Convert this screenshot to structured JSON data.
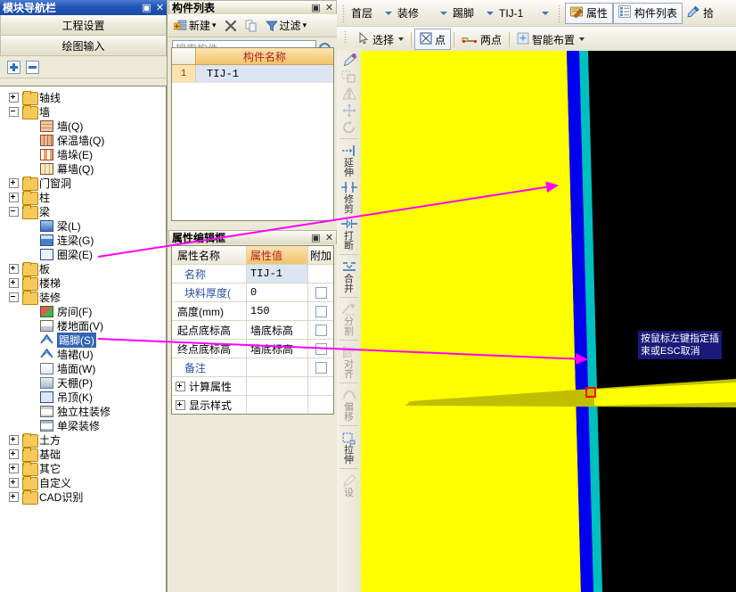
{
  "nav_panel": {
    "title": "模块导航栏",
    "pin": "▣",
    "close": "✕",
    "buttons": [
      {
        "label": "工程设置"
      },
      {
        "label": "绘图输入"
      }
    ],
    "expand_all": "+",
    "collapse_all": "-",
    "tree": [
      {
        "label": "轴线",
        "type": "folder",
        "state": "collapsed",
        "level": 0,
        "icon": "folder-icon"
      },
      {
        "label": "墙",
        "type": "folder",
        "state": "expanded",
        "level": 0,
        "icon": "folder-icon"
      },
      {
        "label": "墙(Q)",
        "type": "leaf",
        "level": 1,
        "icon": "wall-brick-icon"
      },
      {
        "label": "保温墙(Q)",
        "type": "leaf",
        "level": 1,
        "icon": "insulation-wall-icon"
      },
      {
        "label": "墙垛(E)",
        "type": "leaf",
        "level": 1,
        "icon": "wall-pier-icon"
      },
      {
        "label": "幕墙(Q)",
        "type": "leaf",
        "level": 1,
        "icon": "curtain-wall-icon"
      },
      {
        "label": "门窗洞",
        "type": "folder",
        "state": "collapsed",
        "level": 0,
        "icon": "folder-icon"
      },
      {
        "label": "柱",
        "type": "folder",
        "state": "collapsed",
        "level": 0,
        "icon": "folder-icon"
      },
      {
        "label": "梁",
        "type": "folder",
        "state": "expanded",
        "level": 0,
        "icon": "folder-icon"
      },
      {
        "label": "梁(L)",
        "type": "leaf",
        "level": 1,
        "icon": "beam-icon"
      },
      {
        "label": "连梁(G)",
        "type": "leaf",
        "level": 1,
        "icon": "coupling-beam-icon"
      },
      {
        "label": "圈梁(E)",
        "type": "leaf",
        "level": 1,
        "icon": "ring-beam-icon"
      },
      {
        "label": "板",
        "type": "folder",
        "state": "collapsed",
        "level": 0,
        "icon": "folder-icon"
      },
      {
        "label": "楼梯",
        "type": "folder",
        "state": "collapsed",
        "level": 0,
        "icon": "folder-icon"
      },
      {
        "label": "装修",
        "type": "folder",
        "state": "expanded",
        "level": 0,
        "icon": "folder-icon"
      },
      {
        "label": "房间(F)",
        "type": "leaf",
        "level": 1,
        "icon": "room-icon"
      },
      {
        "label": "楼地面(V)",
        "type": "leaf",
        "level": 1,
        "icon": "floor-finish-icon"
      },
      {
        "label": "踢脚(S)",
        "type": "leaf",
        "level": 1,
        "icon": "skirting-icon",
        "selected": true
      },
      {
        "label": "墙裙(U)",
        "type": "leaf",
        "level": 1,
        "icon": "wainscot-icon"
      },
      {
        "label": "墙面(W)",
        "type": "leaf",
        "level": 1,
        "icon": "wall-finish-icon"
      },
      {
        "label": "天棚(P)",
        "type": "leaf",
        "level": 1,
        "icon": "soffit-icon"
      },
      {
        "label": "吊顶(K)",
        "type": "leaf",
        "level": 1,
        "icon": "suspended-ceiling-icon"
      },
      {
        "label": "独立柱装修",
        "type": "leaf",
        "level": 1,
        "icon": "column-finish-icon"
      },
      {
        "label": "单梁装修",
        "type": "leaf",
        "level": 1,
        "icon": "beam-finish-icon"
      },
      {
        "label": "土方",
        "type": "folder",
        "state": "collapsed",
        "level": 0,
        "icon": "folder-icon"
      },
      {
        "label": "基础",
        "type": "folder",
        "state": "collapsed",
        "level": 0,
        "icon": "folder-icon"
      },
      {
        "label": "其它",
        "type": "folder",
        "state": "collapsed",
        "level": 0,
        "icon": "folder-icon"
      },
      {
        "label": "自定义",
        "type": "folder",
        "state": "collapsed",
        "level": 0,
        "icon": "folder-icon"
      },
      {
        "label": "CAD识别",
        "type": "folder",
        "state": "collapsed",
        "level": 0,
        "icon": "folder-icon"
      }
    ]
  },
  "component_panel": {
    "title": "构件列表",
    "pin": "▣",
    "close": "✕",
    "toolbar": {
      "new": "新建",
      "new_caret": "▾",
      "delete_icon": "delete-x-icon",
      "copy_icon": "copy-icon",
      "filter_icon": "funnel-icon",
      "filter": "过滤",
      "filter_caret": "▾"
    },
    "search": {
      "placeholder": "搜索构件...",
      "value": ""
    },
    "columns": [
      "",
      "构件名称"
    ],
    "rows": [
      {
        "index": "1",
        "name": "TIJ-1"
      }
    ]
  },
  "property_panel": {
    "title": "属性编辑框",
    "pin": "▣",
    "close": "✕",
    "columns": {
      "name": "属性名称",
      "value": "属性值",
      "extra": "附加"
    },
    "rows": [
      {
        "name": "名称",
        "value": "TIJ-1",
        "blue": true,
        "readonly": true,
        "checkbox": false
      },
      {
        "name": "块料厚度(",
        "value": "0",
        "blue": true,
        "readonly": false,
        "checkbox": true
      },
      {
        "name": "高度(mm)",
        "value": "150",
        "blue": false,
        "readonly": false,
        "checkbox": true
      },
      {
        "name": "起点底标高",
        "value": "墙底标高",
        "blue": false,
        "readonly": false,
        "checkbox": true
      },
      {
        "name": "终点底标高",
        "value": "墙底标高",
        "blue": false,
        "readonly": false,
        "checkbox": true
      },
      {
        "name": "备注",
        "value": "",
        "blue": true,
        "readonly": false,
        "checkbox": true
      }
    ],
    "groups": [
      {
        "name": "计算属性",
        "expander": "+"
      },
      {
        "name": "显示样式",
        "expander": "+"
      }
    ]
  },
  "toolbar_top": {
    "combos": [
      {
        "label": "首层",
        "name": "floor-select"
      },
      {
        "label": "装修",
        "name": "category-select"
      },
      {
        "label": "踢脚",
        "name": "element-type-select"
      },
      {
        "label": "TIJ-1",
        "name": "component-select"
      }
    ],
    "buttons": [
      {
        "label": "属性",
        "icon": "property-icon",
        "active": true
      },
      {
        "label": "构件列表",
        "icon": "component-list-icon",
        "active": true
      },
      {
        "label": "拾",
        "icon": "eyedropper-icon",
        "active": false
      }
    ]
  },
  "toolbar_draw": {
    "items": [
      {
        "label": "选择",
        "icon": "cursor-icon",
        "caret": true,
        "active": false
      },
      {
        "label": "点",
        "icon": "point-icon",
        "caret": false,
        "active": true
      },
      {
        "label": "两点",
        "icon": "two-point-icon",
        "caret": false,
        "active": false
      },
      {
        "label": "智能布置",
        "icon": "smart-layout-icon",
        "caret": true,
        "active": false
      }
    ]
  },
  "vertical_toolbar": {
    "items": [
      {
        "label": "",
        "icon": "brush-icon",
        "enabled": true
      },
      {
        "label": "",
        "icon": "copy-move-icon",
        "enabled": false
      },
      {
        "label": "",
        "icon": "mirror-icon",
        "enabled": false
      },
      {
        "label": "",
        "icon": "move-icon",
        "enabled": false
      },
      {
        "label": "",
        "icon": "rotate-icon",
        "enabled": false
      },
      {
        "label": "延伸",
        "icon": "extend-icon",
        "enabled": true
      },
      {
        "label": "修剪",
        "icon": "trim-icon",
        "enabled": true
      },
      {
        "label": "打断",
        "icon": "break-icon",
        "enabled": true
      },
      {
        "label": "合并",
        "icon": "merge-icon",
        "enabled": true
      },
      {
        "label": "分割",
        "icon": "split-icon",
        "enabled": false
      },
      {
        "label": "对齐",
        "icon": "align-icon",
        "enabled": false
      },
      {
        "label": "偏移",
        "icon": "offset-icon",
        "enabled": false
      },
      {
        "label": "拉伸",
        "icon": "stretch-icon",
        "enabled": true
      },
      {
        "label": "设",
        "icon": "settings-icon",
        "enabled": false
      }
    ]
  },
  "canvas": {
    "tooltip": [
      "按鼠标左键指定插",
      "束或ESC取消"
    ],
    "colors": {
      "background": "#000000",
      "wall_fill": "#FFFF00",
      "blue_band": "#0000EE",
      "teal_band": "#00BFBF",
      "olive_beam": "#BFBF00",
      "marker": "#FF0000",
      "annotation": "#FF00FF"
    }
  }
}
